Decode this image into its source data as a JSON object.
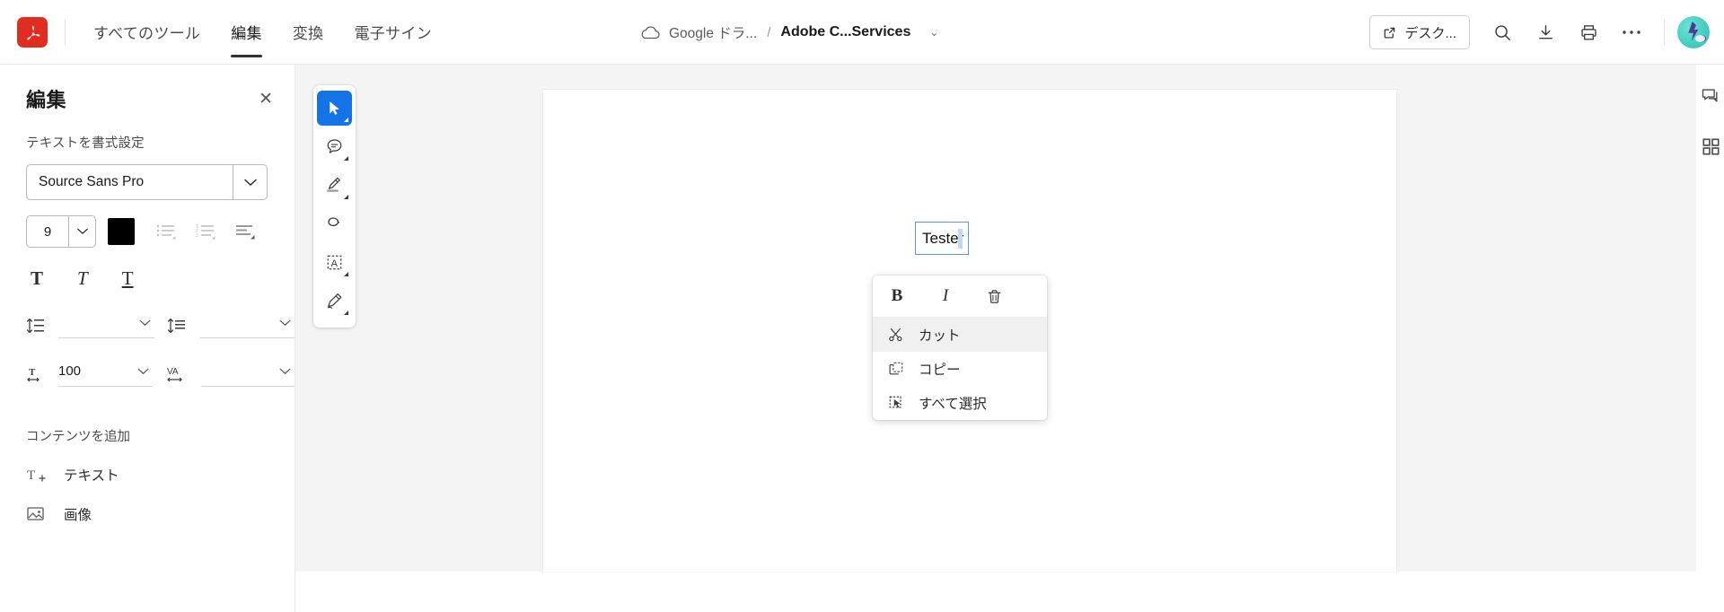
{
  "header": {
    "logo": "acrobat-logo",
    "tabs": [
      {
        "label": "すべてのツール",
        "active": false
      },
      {
        "label": "編集",
        "active": true
      },
      {
        "label": "変換",
        "active": false
      },
      {
        "label": "電子サイン",
        "active": false
      }
    ],
    "breadcrumb": {
      "cloud_icon": "cloud-icon",
      "location": "Google ドラ...",
      "separator": "/",
      "filename": "Adobe C...Services",
      "chevron": "⌄"
    },
    "right": {
      "desktop_button": "デスク...",
      "desktop_icon": "external-link-icon",
      "search_icon": "search-icon",
      "download_icon": "download-icon",
      "print_icon": "print-icon",
      "more_icon": "ellipsis-icon",
      "avatar": "user-avatar"
    }
  },
  "left_panel": {
    "title": "編集",
    "close": "✕",
    "format_label": "テキストを書式設定",
    "font": {
      "value": "Source Sans Pro",
      "chevron": "⌄"
    },
    "size": {
      "value": "9",
      "chevron": "⌄"
    },
    "color": "#000000",
    "list_icons": [
      "bullet-list-icon",
      "numbered-list-icon",
      "align-icon"
    ],
    "style_buttons": [
      {
        "name": "bold-button",
        "glyph": "T"
      },
      {
        "name": "italic-button",
        "glyph": "T"
      },
      {
        "name": "underline-button",
        "glyph": "T"
      }
    ],
    "spacing": {
      "line_spacing": {
        "icon": "line-spacing-icon",
        "value": "",
        "chevron": "⌄"
      },
      "paragraph_spacing": {
        "icon": "paragraph-spacing-icon",
        "value": "",
        "chevron": "⌄"
      },
      "horizontal_scale": {
        "icon": "horizontal-scale-icon",
        "value": "100",
        "chevron": "⌄"
      },
      "tracking": {
        "icon": "tracking-icon",
        "label": "VA",
        "value": "",
        "chevron": "⌄"
      }
    },
    "add_content_label": "コンテンツを追加",
    "add_items": [
      {
        "icon": "add-text-icon",
        "label": "テキスト"
      },
      {
        "icon": "add-image-icon",
        "label": "画像"
      }
    ]
  },
  "tool_rail": [
    {
      "name": "select-tool",
      "active": true
    },
    {
      "name": "comment-tool",
      "active": false
    },
    {
      "name": "highlight-tool",
      "active": false
    },
    {
      "name": "draw-tool",
      "active": false
    },
    {
      "name": "add-text-box-tool",
      "active": false
    },
    {
      "name": "sign-tool",
      "active": false
    }
  ],
  "right_rail": [
    {
      "name": "comments-panel-icon"
    },
    {
      "name": "all-tools-grid-icon"
    }
  ],
  "document": {
    "textbox_value": "Tester"
  },
  "context_menu": {
    "format_buttons": [
      {
        "name": "bold",
        "glyph": "B"
      },
      {
        "name": "italic",
        "glyph": "I"
      },
      {
        "name": "delete",
        "glyph": "trash-icon"
      }
    ],
    "items": [
      {
        "icon": "scissors-icon",
        "label": "カット",
        "hovered": true
      },
      {
        "icon": "copy-icon",
        "label": "コピー",
        "hovered": false
      },
      {
        "icon": "select-all-icon",
        "label": "すべて選択",
        "hovered": false
      }
    ]
  },
  "colors": {
    "accent_blue": "#1473e6",
    "logo_red": "#e02d21",
    "canvas_gray": "#f4f4f4",
    "selection_blue": "#5b9bd5"
  }
}
